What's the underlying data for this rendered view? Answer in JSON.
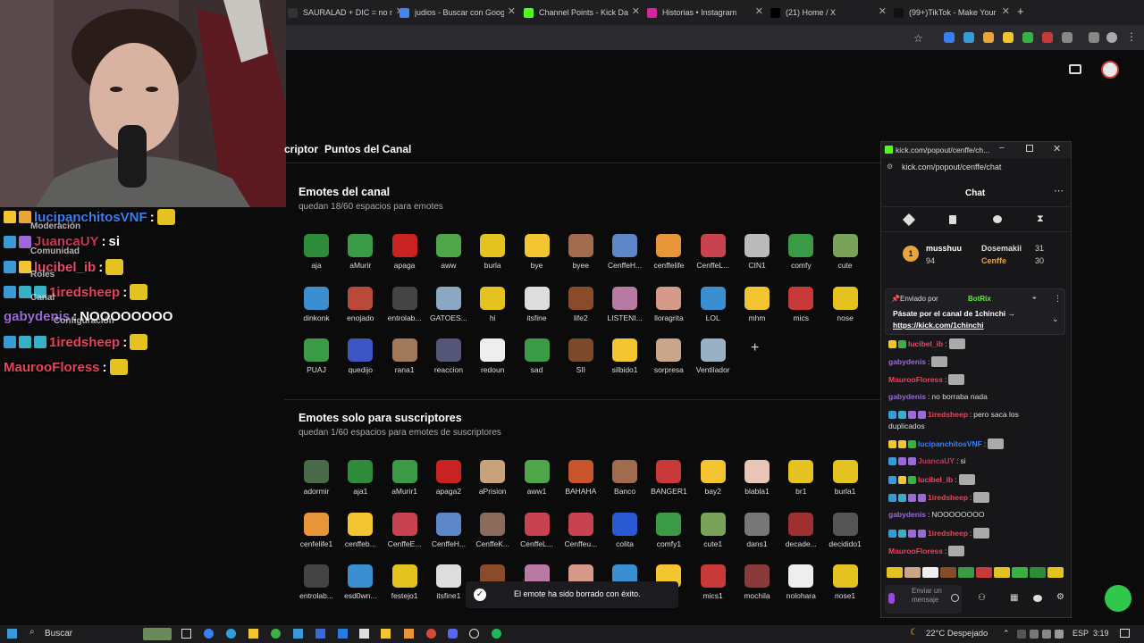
{
  "browser": {
    "tabs": [
      {
        "label": "SAURALAD + DIC = no m",
        "fav": "#333"
      },
      {
        "label": "judios - Buscar con Goog",
        "fav": "#4285f4"
      },
      {
        "label": "Channel Points - Kick Das",
        "fav": "#53fc18"
      },
      {
        "label": "Historias • Instagram",
        "fav": "#d6249f"
      },
      {
        "label": "(21) Home / X",
        "fav": "#000"
      },
      {
        "label": "(99+)TikTok - Make Your",
        "fav": "#111"
      }
    ],
    "new_tab": "+"
  },
  "dashboard": {
    "nav": {
      "tab_subscriptor": "criptor",
      "tab_points": "Puntos del Canal"
    },
    "channel_emotes": {
      "title": "Emotes del canal",
      "subtitle": "quedan 18/60 espacios para emotes",
      "items": [
        {
          "name": "aja",
          "color": "#2e8b3a"
        },
        {
          "name": "aMurir",
          "color": "#3a9a45"
        },
        {
          "name": "apaga",
          "color": "#c82222"
        },
        {
          "name": "aww",
          "color": "#4ea54a"
        },
        {
          "name": "burla",
          "color": "#e4c320"
        },
        {
          "name": "bye",
          "color": "#f2c531"
        },
        {
          "name": "byee",
          "color": "#a06c4d"
        },
        {
          "name": "CenffeH...",
          "color": "#5e87c9"
        },
        {
          "name": "cenffelife",
          "color": "#e8953a"
        },
        {
          "name": "CenffeL...",
          "color": "#c8434f"
        },
        {
          "name": "CIN1",
          "color": "#bbbbbb"
        },
        {
          "name": "comfy",
          "color": "#3a9a45"
        },
        {
          "name": "cute",
          "color": "#7aa35a"
        },
        {
          "name": "dinkonk",
          "color": "#3b8fd1"
        },
        {
          "name": "enojado",
          "color": "#b94a3a"
        },
        {
          "name": "entrolab...",
          "color": "#444444"
        },
        {
          "name": "GATOES...",
          "color": "#8aa7c4"
        },
        {
          "name": "hi",
          "color": "#e4c320"
        },
        {
          "name": "itsfine",
          "color": "#dddddd"
        },
        {
          "name": "life2",
          "color": "#8a4b2a"
        },
        {
          "name": "LISTENI...",
          "color": "#b87aa3"
        },
        {
          "name": "lloragrita",
          "color": "#d69a8a"
        },
        {
          "name": "LOL",
          "color": "#3a8fd1"
        },
        {
          "name": "mhm",
          "color": "#f2c531"
        },
        {
          "name": "mics",
          "color": "#c83a3a"
        },
        {
          "name": "nose",
          "color": "#e4c320"
        },
        {
          "name": "PUAJ",
          "color": "#3a9a45"
        },
        {
          "name": "quedijo",
          "color": "#3e56c4"
        },
        {
          "name": "rana1",
          "color": "#a07a5a"
        },
        {
          "name": "reaccion",
          "color": "#555577"
        },
        {
          "name": "redoun",
          "color": "#eeeeee"
        },
        {
          "name": "sad",
          "color": "#3a9a45"
        },
        {
          "name": "SII",
          "color": "#7a4a2a"
        },
        {
          "name": "silbido1",
          "color": "#f2c531"
        },
        {
          "name": "sorpresa",
          "color": "#c9a58a"
        },
        {
          "name": "Ventilador",
          "color": "#9ab0c4"
        }
      ],
      "add_label": "+"
    },
    "sub_emotes": {
      "title": "Emotes solo para suscriptores",
      "subtitle": "quedan 1/60 espacios para emotes de suscriptores",
      "items": [
        {
          "name": "adormir",
          "color": "#4a6a4a"
        },
        {
          "name": "aja1",
          "color": "#2e8b3a"
        },
        {
          "name": "aMurir1",
          "color": "#3a9a45"
        },
        {
          "name": "apaga2",
          "color": "#c82222"
        },
        {
          "name": "aPrision",
          "color": "#c7a27a"
        },
        {
          "name": "aww1",
          "color": "#4ea54a"
        },
        {
          "name": "BAHAHA",
          "color": "#c8552a"
        },
        {
          "name": "Banco",
          "color": "#a06c4d"
        },
        {
          "name": "BANGER1",
          "color": "#c83a3a"
        },
        {
          "name": "bay2",
          "color": "#f2c531"
        },
        {
          "name": "blabla1",
          "color": "#e8c5b5"
        },
        {
          "name": "br1",
          "color": "#e4c320"
        },
        {
          "name": "burla1",
          "color": "#e4c320"
        },
        {
          "name": "cenfelife1",
          "color": "#e8953a"
        },
        {
          "name": "cenffeb...",
          "color": "#f2c531"
        },
        {
          "name": "CenffeE...",
          "color": "#c8434f"
        },
        {
          "name": "CenffeH...",
          "color": "#5e87c9"
        },
        {
          "name": "CenffeK...",
          "color": "#8a6a5a"
        },
        {
          "name": "CenffeL...",
          "color": "#c8434f"
        },
        {
          "name": "Cenffeu...",
          "color": "#c8434f"
        },
        {
          "name": "colita",
          "color": "#2a5ad1"
        },
        {
          "name": "comfy1",
          "color": "#3a9a45"
        },
        {
          "name": "cute1",
          "color": "#7aa35a"
        },
        {
          "name": "dans1",
          "color": "#777777"
        },
        {
          "name": "decade...",
          "color": "#a03030"
        },
        {
          "name": "decidido1",
          "color": "#555555"
        },
        {
          "name": "entrolab...",
          "color": "#444444"
        },
        {
          "name": "esd0wn...",
          "color": "#3a8fd1"
        },
        {
          "name": "festejo1",
          "color": "#e4c320"
        },
        {
          "name": "itsfine1",
          "color": "#dddddd"
        },
        {
          "name": "",
          "color": "#8a4b2a"
        },
        {
          "name": "",
          "color": "#b87aa3"
        },
        {
          "name": "",
          "color": "#d69a8a"
        },
        {
          "name": "",
          "color": "#3a8fd1"
        },
        {
          "name": "",
          "color": "#f2c531"
        },
        {
          "name": "mics1",
          "color": "#c83a3a"
        },
        {
          "name": "mochila",
          "color": "#8a3a3a"
        },
        {
          "name": "nolohara",
          "color": "#eeeeee"
        },
        {
          "name": "nose1",
          "color": "#e4c320"
        }
      ]
    }
  },
  "toast": {
    "message": "El emote ha sido borrado con éxito."
  },
  "overlay": {
    "lines": [
      {
        "user": "lucipanchitosVNF",
        "user_color": "#3a7ff0",
        "text": ""
      },
      {
        "user": "JuancaUY",
        "user_color": "#c8375a",
        "text": "si"
      },
      {
        "user": "lucibel_ib",
        "user_color": "#e84a6a",
        "text": ""
      },
      {
        "user": "1iredsheep",
        "user_color": "#e8445a",
        "text": ""
      },
      {
        "user": "gabydenis",
        "user_color": "#9a6ad6",
        "text": "NOOOOOOOO"
      },
      {
        "user": "1iredsheep",
        "user_color": "#e8445a",
        "text": ""
      },
      {
        "user": "MaurooFloress",
        "user_color": "#e8445a",
        "text": ""
      }
    ],
    "menu": [
      "Moderación",
      "Comunidad",
      "Roles",
      "Canal",
      "Configuración"
    ]
  },
  "popout": {
    "window_title": "kick.com/popout/cenffe/ch...",
    "url": "kick.com/popout/cenffe/chat",
    "header": "Chat",
    "leaders": [
      {
        "name": "musshuu",
        "points": "94"
      },
      {
        "name": "Dosemakii",
        "points": "31"
      },
      {
        "name": "Cenffe",
        "points": "30"
      }
    ],
    "pinned": {
      "sent_by_label": "Enviado por",
      "bot": "BotRix",
      "message": "Pásate por el canal de 1chinchi →",
      "link": "https://kick.com/1chinchi"
    },
    "messages": [
      {
        "user": "lucibel_ib",
        "color": "#e84a6a",
        "text": ""
      },
      {
        "user": "gabydenis",
        "color": "#9a6ad6",
        "text": ""
      },
      {
        "user": "MaurooFloress",
        "color": "#e8445a",
        "text": ""
      },
      {
        "user": "gabydenis",
        "color": "#9a6ad6",
        "text": "no borraba nada"
      },
      {
        "user": "1iredsheep",
        "color": "#e8445a",
        "text": "pero saca los"
      },
      {
        "user": "",
        "color": "#ddd",
        "text": "duplicados"
      },
      {
        "user": "lucipanchitosVNF",
        "color": "#3a7ff0",
        "text": ""
      },
      {
        "user": "JuancaUY",
        "color": "#c8375a",
        "text": "si"
      },
      {
        "user": "lucibel_ib",
        "color": "#e84a6a",
        "text": ""
      },
      {
        "user": "1iredsheep",
        "color": "#e8445a",
        "text": ""
      },
      {
        "user": "gabydenis",
        "color": "#9a6ad6",
        "text": "NOOOOOOOO"
      },
      {
        "user": "1iredsheep",
        "color": "#e8445a",
        "text": ""
      },
      {
        "user": "MaurooFloress",
        "color": "#e8445a",
        "text": ""
      }
    ],
    "input_placeholder": "Enviar un mensaje"
  },
  "taskbar": {
    "search": "Buscar",
    "weather": "22°C Despejado",
    "lang": "ESP",
    "time": "3:19"
  }
}
